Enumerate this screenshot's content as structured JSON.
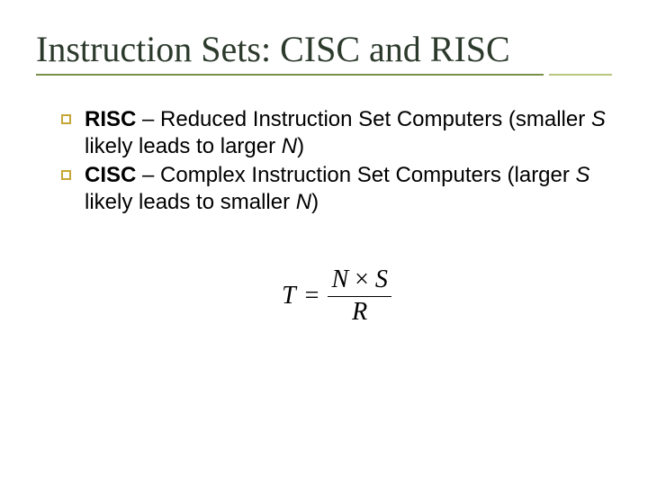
{
  "title": "Instruction Sets: CISC and RISC",
  "bullets": [
    {
      "term": "RISC",
      "dash": " – ",
      "desc1": "Reduced Instruction Set Computers (smaller ",
      "var1": "S",
      "desc2": " likely leads to larger ",
      "var2": "N",
      "desc3": ")"
    },
    {
      "term": "CISC",
      "dash": " – ",
      "desc1": "Complex Instruction Set Computers (larger ",
      "var1": "S",
      "desc2": " likely leads to smaller ",
      "var2": "N",
      "desc3": ")"
    }
  ],
  "formula": {
    "lhs": "T",
    "eq": "=",
    "num_n": "N",
    "num_times": "×",
    "num_s": "S",
    "den": "R"
  }
}
